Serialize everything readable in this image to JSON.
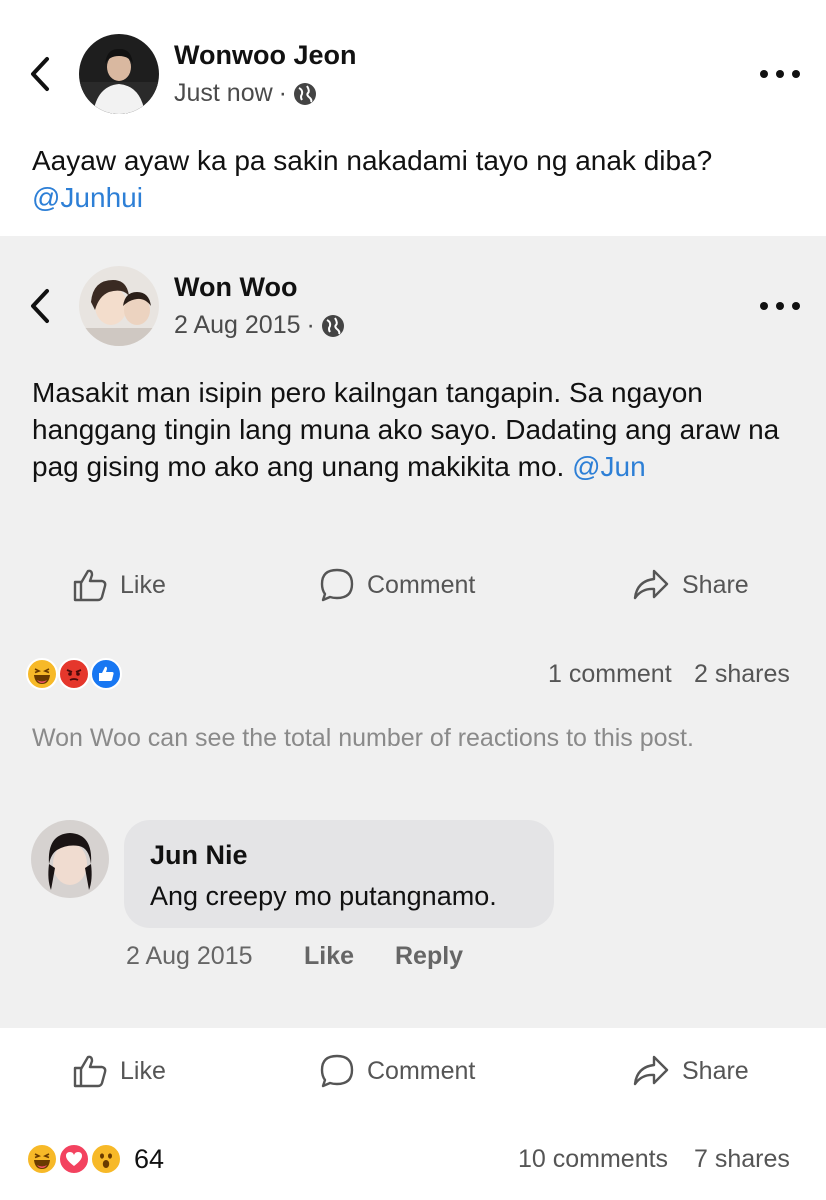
{
  "colors": {
    "mention": "#2d7fd6",
    "shared_bg": "#f0f0f0",
    "bubble_bg": "#e4e4e6",
    "like_blue": "#1877f2",
    "angry_red": "#e5372c",
    "love_red": "#f3425f",
    "haha_yellow": "#f7b928"
  },
  "outer_post": {
    "author": "Wonwoo Jeon",
    "time": "Just now",
    "text": "Aayaw ayaw ka pa sakin nakadami tayo ng anak diba?",
    "mention": "@Junhui",
    "actions": {
      "like": "Like",
      "comment": "Comment",
      "share": "Share"
    },
    "reaction_icons": [
      "haha-icon",
      "love-icon",
      "wow-icon"
    ],
    "reaction_count": "64",
    "comments": "10 comments",
    "shares": "7 shares"
  },
  "shared_post": {
    "author": "Won Woo",
    "time": "2 Aug 2015",
    "text": "Masakit man isipin pero kailngan tangapin. Sa ngayon hanggang tingin lang muna ako sayo. Dadating ang araw na pag gising mo ako ang unang makikita mo.",
    "mention": "@Jun",
    "actions": {
      "like": "Like",
      "comment": "Comment",
      "share": "Share"
    },
    "reaction_icons": [
      "haha-icon",
      "angry-icon",
      "like-icon"
    ],
    "comments": "1 comment",
    "shares": "2 shares",
    "notice": "Won Woo can see the total number of reactions to this post.",
    "comment": {
      "author": "Jun Nie",
      "text": "Ang creepy mo putangnamo.",
      "date": "2 Aug 2015",
      "like": "Like",
      "reply": "Reply"
    }
  }
}
